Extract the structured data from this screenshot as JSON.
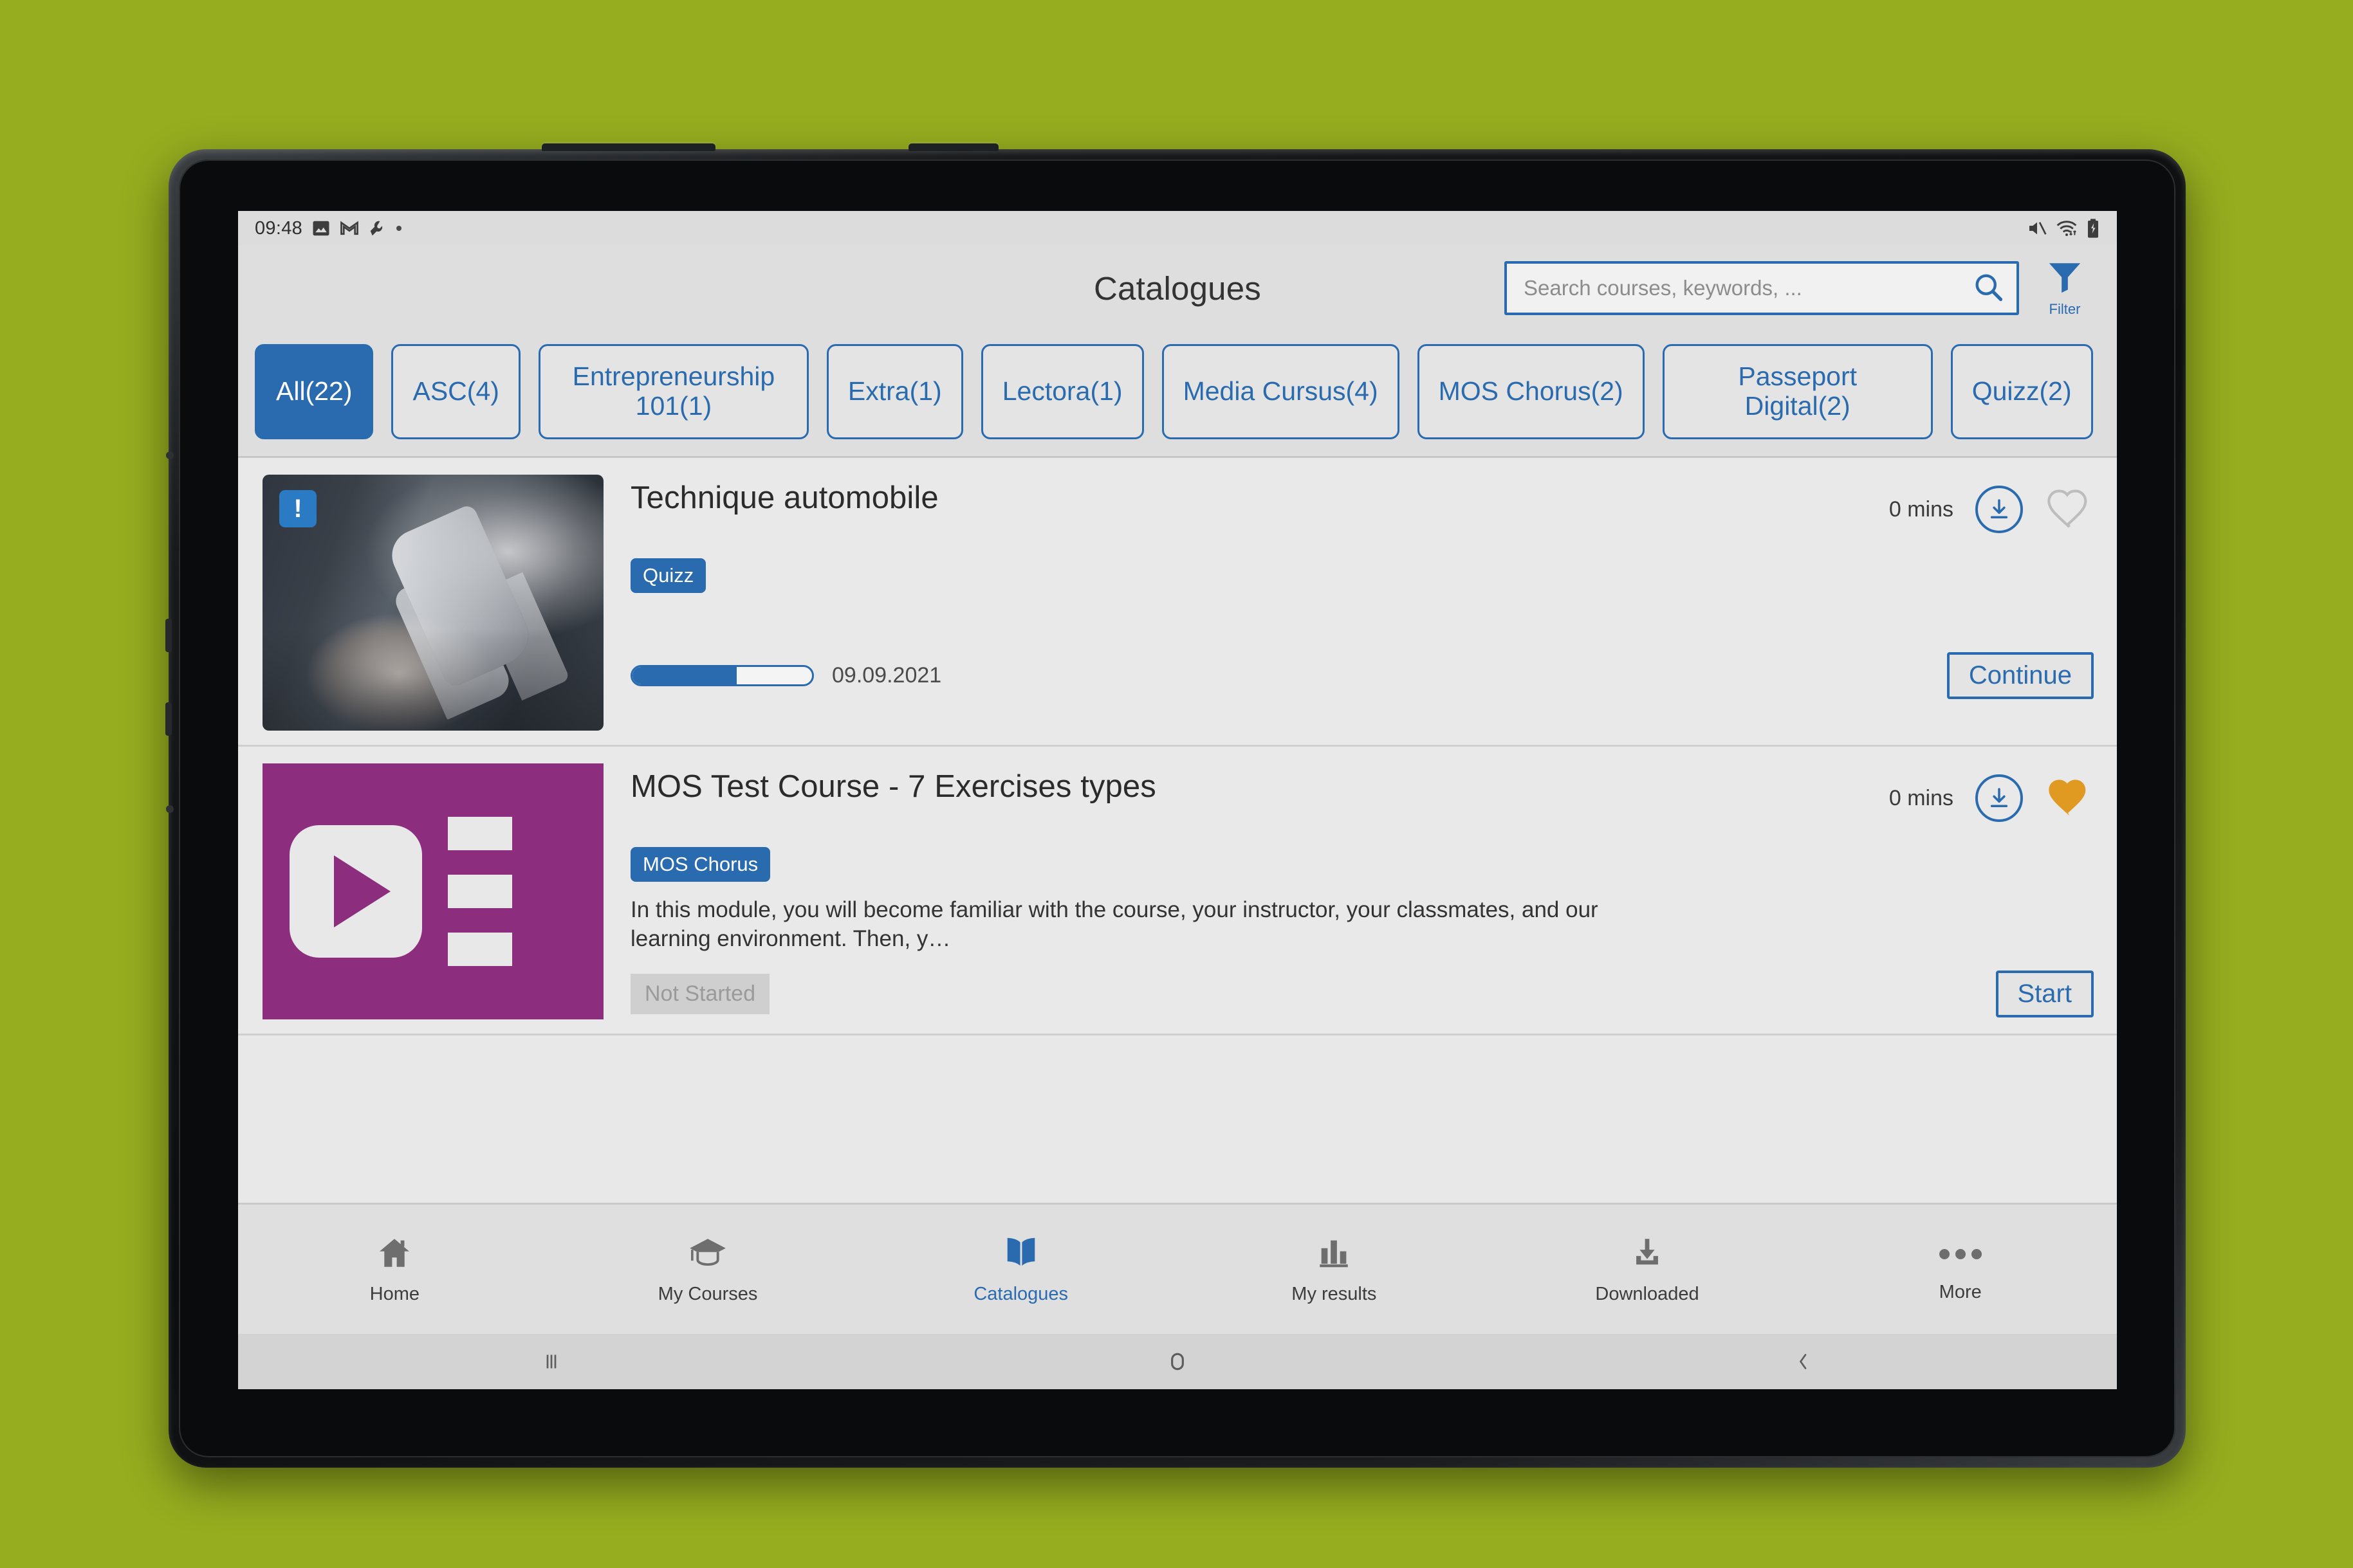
{
  "status_bar": {
    "time": "09:48",
    "left_icons": [
      "image-icon",
      "gmail-icon",
      "wrench-icon",
      "dot-icon"
    ],
    "right_icons": [
      "mute-icon",
      "wifi-icon",
      "battery-charging-icon"
    ]
  },
  "header": {
    "title": "Catalogues",
    "search": {
      "value": "",
      "placeholder": "Search courses, keywords, ..."
    },
    "filter_label": "Filter",
    "accent_color": "#2a6bb0"
  },
  "categories": [
    {
      "label": "All(22)",
      "active": true
    },
    {
      "label": "ASC(4)",
      "active": false
    },
    {
      "label": "Entrepreneurship 101(1)",
      "active": false
    },
    {
      "label": "Extra(1)",
      "active": false
    },
    {
      "label": "Lectora(1)",
      "active": false
    },
    {
      "label": "Media Cursus(4)",
      "active": false
    },
    {
      "label": "MOS Chorus(2)",
      "active": false
    },
    {
      "label": "Passeport Digital(2)",
      "active": false
    },
    {
      "label": "Quizz(2)",
      "active": false
    }
  ],
  "courses": [
    {
      "title": "Technique automobile",
      "tag": "Quizz",
      "duration": "0 mins",
      "description": "",
      "alert_badge": "!",
      "progress_percent": 58,
      "date": "09.09.2021",
      "status": "",
      "action_label": "Continue",
      "favorite": false,
      "thumbnail": "mechanic-photo"
    },
    {
      "title": "MOS Test Course - 7 Exercises types",
      "tag": "MOS Chorus",
      "duration": "0 mins",
      "description": "In this module, you will become familiar with the course, your instructor, your classmates, and our learning environment. Then, y…",
      "alert_badge": "",
      "progress_percent": 0,
      "date": "",
      "status": "Not Started",
      "action_label": "Start",
      "favorite": true,
      "favorite_color": "#e09a22",
      "thumbnail": "mos-chorus-logo"
    }
  ],
  "bottom_nav": [
    {
      "label": "Home",
      "icon": "home-icon",
      "active": false
    },
    {
      "label": "My Courses",
      "icon": "graduation-cap-icon",
      "active": false
    },
    {
      "label": "Catalogues",
      "icon": "open-book-icon",
      "active": true
    },
    {
      "label": "My results",
      "icon": "bar-chart-icon",
      "active": false
    },
    {
      "label": "Downloaded",
      "icon": "download-tray-icon",
      "active": false
    },
    {
      "label": "More",
      "icon": "ellipsis-icon",
      "active": false
    }
  ],
  "system_nav": [
    {
      "name": "recents-button",
      "icon": "three-lines-icon"
    },
    {
      "name": "home-button",
      "icon": "circle-icon"
    },
    {
      "name": "back-button",
      "icon": "chevron-left-icon"
    }
  ]
}
